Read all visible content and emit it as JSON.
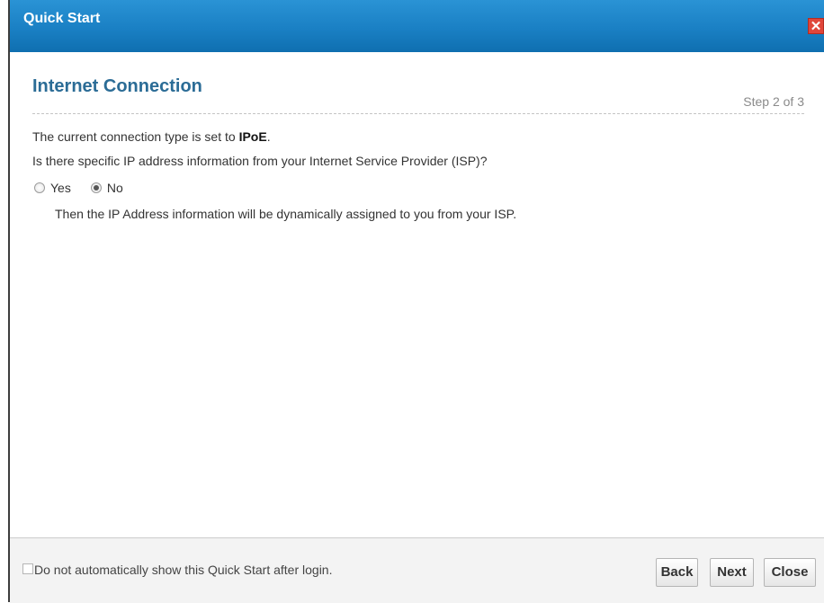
{
  "window": {
    "title": "Quick Start",
    "close_glyph": "✕"
  },
  "content": {
    "section_title": "Internet Connection",
    "step": "Step 2 of 3",
    "connection_prefix": "The current connection type is set to ",
    "connection_type": "IPoE",
    "connection_suffix": ".",
    "question": "Is there specific IP address information from your Internet Service Provider (ISP)?",
    "radio_options": [
      {
        "label": "Yes",
        "selected": false
      },
      {
        "label": "No",
        "selected": true
      }
    ],
    "note": "Then the IP Address information will be dynamically assigned to you from your ISP."
  },
  "footer": {
    "checkbox_label": "Do not automatically show this Quick Start after login.",
    "checkbox_checked": false,
    "buttons": {
      "back": "Back",
      "next": "Next",
      "close": "Close"
    }
  },
  "colors": {
    "titlebar": "#1a80c4",
    "section_title": "#2b6c96",
    "close_button": "#e0463a"
  }
}
